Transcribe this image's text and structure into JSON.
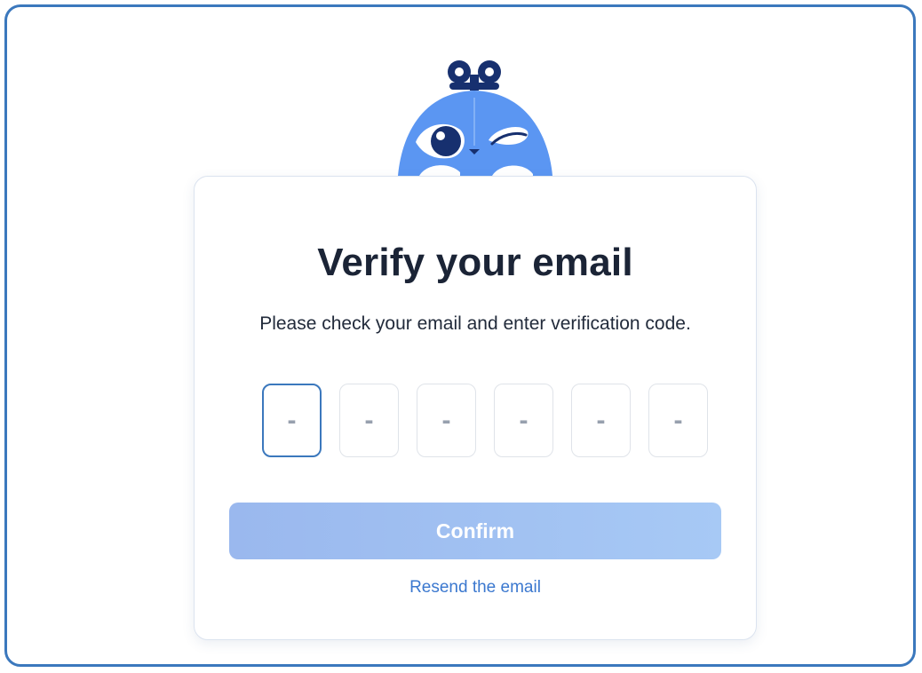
{
  "verify": {
    "title": "Verify your email",
    "subtitle": "Please check your email and enter verification code.",
    "code_placeholders": [
      "-",
      "-",
      "-",
      "-",
      "-",
      "-"
    ],
    "confirm_label": "Confirm",
    "resend_label": "Resend the email"
  },
  "colors": {
    "frame_border": "#3b78bd",
    "mascot_body": "#5b96f2",
    "mascot_dark": "#17306f",
    "button_start": "#9ab8ee",
    "button_end": "#a7c9f5",
    "link": "#3b78cf",
    "title": "#1b2436"
  },
  "icons": {
    "mascot": "bird-mascot-icon"
  }
}
